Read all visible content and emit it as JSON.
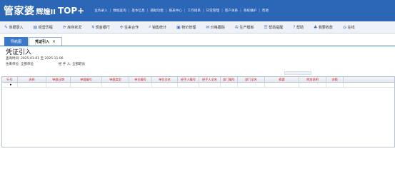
{
  "app": {
    "logo_main": "管家婆",
    "logo_sub": "辉煌II",
    "logo_edition": "TOP+"
  },
  "topnav": [
    "业务录入",
    "数据查询",
    "基本信息",
    "辅助功能",
    "报表中心",
    "工作组系",
    "日常管理",
    "客户关系",
    "系统维护",
    "帮助"
  ],
  "toolbar": [
    {
      "icon": "document-icon",
      "glyph": "✎",
      "label": "单据录入"
    },
    {
      "icon": "chart-icon",
      "glyph": "▤",
      "label": "经营历程"
    },
    {
      "icon": "refresh-icon",
      "glyph": "⟳",
      "label": "库存状况"
    },
    {
      "icon": "money-icon",
      "glyph": "¥",
      "label": "现金银行"
    },
    {
      "icon": "handshake-icon",
      "glyph": "✣",
      "label": "往来合作"
    },
    {
      "icon": "search-icon",
      "glyph": "⌕",
      "label": "销售统计"
    },
    {
      "icon": "box-icon",
      "glyph": "▣",
      "label": "物价管理"
    },
    {
      "icon": "mail-icon",
      "glyph": "✉",
      "label": "价格跟踪"
    },
    {
      "icon": "wrench-icon",
      "glyph": "✇",
      "label": "生产模板"
    },
    {
      "icon": "notes-icon",
      "glyph": "☰",
      "label": "帮助提醒"
    },
    {
      "icon": "question-icon",
      "glyph": "?",
      "label": "帮助"
    },
    {
      "icon": "users-icon",
      "glyph": "♣",
      "label": "我要收款"
    },
    {
      "icon": "globe-icon",
      "glyph": "◎",
      "label": "在线"
    }
  ],
  "tabs": {
    "nav": "导航图",
    "active": "凭证引入",
    "close": "×"
  },
  "document": {
    "title": "凭证引入",
    "date_label": "查询时间:",
    "date_from": "2025-01-01",
    "date_to_label": "至",
    "date_to": "2025-11-06",
    "unit_label": "往来单位:",
    "unit_value": "全部单位",
    "handler_label": "经 手 人:",
    "handler_value": "全部职员"
  },
  "grid": {
    "columns": [
      "行号",
      "选择",
      "单据日期",
      "单据编号",
      "单据类型",
      "单位编号",
      "单位全名",
      "经手人编号",
      "经手人全名",
      "部门编号",
      "部门全名",
      "摘要",
      "附加说明",
      "金额"
    ],
    "current_row_marker": "▸"
  }
}
